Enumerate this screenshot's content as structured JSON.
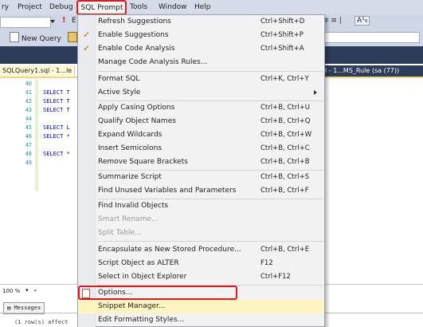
{
  "menubar": {
    "items": [
      "ry",
      "Project",
      "Debug",
      "SQL Prompt",
      "Tools",
      "Window",
      "Help"
    ],
    "active": "SQL Prompt"
  },
  "toolbar1": {
    "stop_glyph": "!",
    "partial_label": "E",
    "right_icons": "≡ ≡ |",
    "font_size_label": "A¹₀"
  },
  "toolbar2": {
    "new_query_label": "New Query"
  },
  "tabs": {
    "active_tab": "SQLQuery1.sql - 1...le",
    "right_tab": "l - 1...MS_Rule (sa (77))"
  },
  "editor": {
    "lines": [
      {
        "num": "40",
        "code": ""
      },
      {
        "num": "41",
        "code": "SELECT T"
      },
      {
        "num": "42",
        "code": "SELECT T"
      },
      {
        "num": "43",
        "code": "SELECT T"
      },
      {
        "num": "44",
        "code": ""
      },
      {
        "num": "45",
        "code": "SELECT L"
      },
      {
        "num": "46",
        "code": "SELECT *"
      },
      {
        "num": "47",
        "code": ""
      },
      {
        "num": "48",
        "code": "SELECT *"
      },
      {
        "num": "49",
        "code": ""
      }
    ]
  },
  "status": {
    "zoom": "100 %",
    "messages_tab": "Messages",
    "message_text": "(1 row(s) affect"
  },
  "dropdown": {
    "items": [
      {
        "label": "Refresh Suggestions",
        "shortcut": "Ctrl+Shift+D",
        "checked": false,
        "disabled": false
      },
      {
        "label": "Enable Suggestions",
        "shortcut": "Ctrl+Shift+P",
        "checked": true,
        "disabled": false
      },
      {
        "label": "Enable Code Analysis",
        "shortcut": "Ctrl+Shift+A",
        "checked": true,
        "disabled": false
      },
      {
        "label": "Manage Code Analysis Rules...",
        "shortcut": "",
        "checked": false,
        "disabled": false
      },
      {
        "label": "Format SQL",
        "shortcut": "Ctrl+K, Ctrl+Y",
        "checked": false,
        "disabled": false
      },
      {
        "label": "Active Style",
        "shortcut": "",
        "checked": false,
        "disabled": false,
        "submenu": true
      },
      {
        "label": "Apply Casing Options",
        "shortcut": "Ctrl+B, Ctrl+U",
        "checked": false,
        "disabled": false
      },
      {
        "label": "Qualify Object Names",
        "shortcut": "Ctrl+B, Ctrl+Q",
        "checked": false,
        "disabled": false
      },
      {
        "label": "Expand Wildcards",
        "shortcut": "Ctrl+B, Ctrl+W",
        "checked": false,
        "disabled": false
      },
      {
        "label": "Insert Semicolons",
        "shortcut": "Ctrl+B, Ctrl+C",
        "checked": false,
        "disabled": false
      },
      {
        "label": "Remove Square Brackets",
        "shortcut": "Ctrl+B, Ctrl+B",
        "checked": false,
        "disabled": false
      },
      {
        "label": "Summarize Script",
        "shortcut": "Ctrl+B, Ctrl+S",
        "checked": false,
        "disabled": false
      },
      {
        "label": "Find Unused Variables and Parameters",
        "shortcut": "Ctrl+B, Ctrl+F",
        "checked": false,
        "disabled": false
      },
      {
        "label": "Find Invalid Objects",
        "shortcut": "",
        "checked": false,
        "disabled": false
      },
      {
        "label": "Smart Rename...",
        "shortcut": "",
        "checked": false,
        "disabled": true
      },
      {
        "label": "Split Table...",
        "shortcut": "",
        "checked": false,
        "disabled": true
      },
      {
        "label": "Encapsulate as New Stored Procedure...",
        "shortcut": "Ctrl+B, Ctrl+E",
        "checked": false,
        "disabled": false
      },
      {
        "label": "Script Object as ALTER",
        "shortcut": "F12",
        "checked": false,
        "disabled": false
      },
      {
        "label": "Select in Object Explorer",
        "shortcut": "Ctrl+F12",
        "checked": false,
        "disabled": false
      },
      {
        "label": "Options...",
        "shortcut": "",
        "checked": false,
        "disabled": false,
        "highlighted_box": true
      },
      {
        "label": "Snippet Manager...",
        "shortcut": "",
        "checked": false,
        "disabled": false,
        "hover": true
      },
      {
        "label": "Edit Formatting Styles...",
        "shortcut": "",
        "checked": false,
        "disabled": false
      }
    ],
    "check_glyph": "✓"
  },
  "colors": {
    "highlight_box": "#e0191d",
    "menu_hover": "#fdf4bf",
    "check_mark": "#c96400",
    "tab_strip": "#2d3c58",
    "line_number": "#2b91af",
    "keyword": "#0000ff"
  }
}
